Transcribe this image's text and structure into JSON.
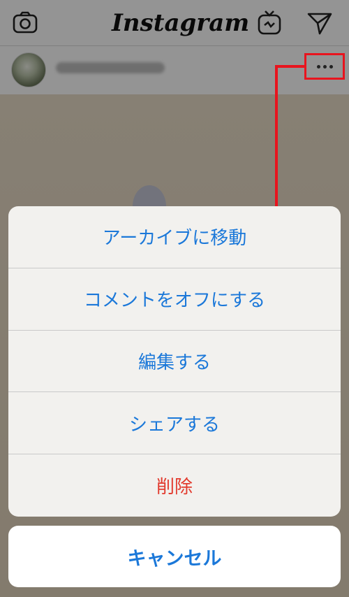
{
  "app": {
    "logo_text": "Instagram"
  },
  "topbar": {
    "icons": [
      "camera-icon",
      "igtv-icon",
      "direct-message-icon"
    ]
  },
  "post": {
    "more_icon": "more-horizontal-icon"
  },
  "action_sheet": {
    "items": [
      {
        "label": "アーカイブに移動"
      },
      {
        "label": "コメントをオフにする"
      },
      {
        "label": "編集する"
      },
      {
        "label": "シェアする"
      },
      {
        "label": "削除",
        "color": "#e23b2e"
      }
    ],
    "cancel_label": "キャンセル"
  },
  "colors": {
    "action_blue": "#1b78d9",
    "destructive_red": "#e23b2e",
    "highlight_red": "#e8141e"
  }
}
